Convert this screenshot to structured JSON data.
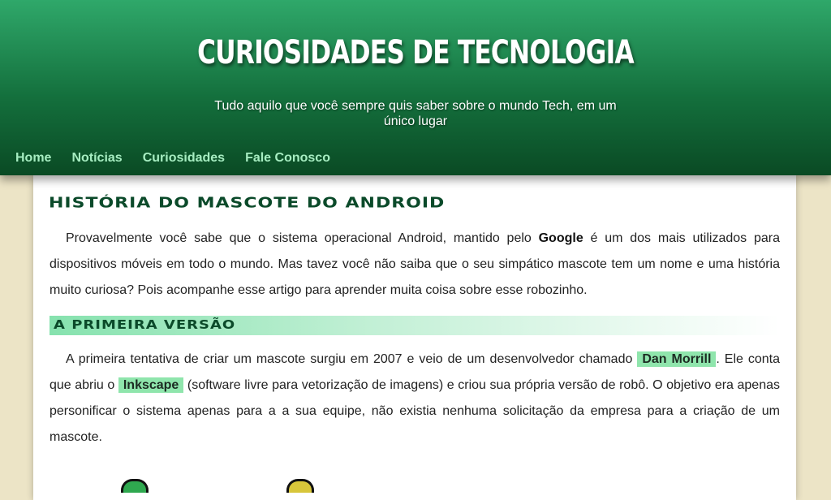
{
  "header": {
    "title": "CURIOSIDADES DE TECNOLOGIA",
    "subtitle": "Tudo aquilo que você sempre quis saber sobre o mundo Tech, em um único lugar"
  },
  "nav": {
    "items": [
      {
        "label": "Home"
      },
      {
        "label": "Notícias"
      },
      {
        "label": "Curiosidades"
      },
      {
        "label": "Fale Conosco"
      }
    ]
  },
  "article": {
    "title": "História do Mascote do Android",
    "intro": {
      "part1": "Provavelmente você sabe que o sistema operacional Android, mantido pelo ",
      "bold": "Google",
      "part2": " é um dos mais utilizados para dispositivos móveis em todo o mundo. Mas tavez você não saiba que o seu simpático mascote tem um nome e uma história muito curiosa? Pois acompanhe esse artigo para aprender muita coisa sobre esse robozinho."
    },
    "section1": {
      "title": "A primeira versão",
      "part1": "A primeira tentativa de criar um mascote surgiu em 2007 e veio de um desenvolvedor chamado ",
      "highlight1": "Dan Morrill",
      "part2": ". Ele conta que abriu o ",
      "highlight2": "Inkscape",
      "part3": " (software livre para vetorização de imagens) e criou sua própria versão de robô. O objetivo era apenas personificar o sistema apenas para a a sua equipe, não existia nenhuma solicitação da empresa para a criação de um mascote."
    }
  },
  "colors": {
    "header_top": "#2fa86a",
    "header_bottom": "#0a4a24",
    "nav_link": "#a6edc1",
    "highlight": "#8fe5ac",
    "heading": "#0b4a2a",
    "page_bg": "#ece4c6"
  }
}
